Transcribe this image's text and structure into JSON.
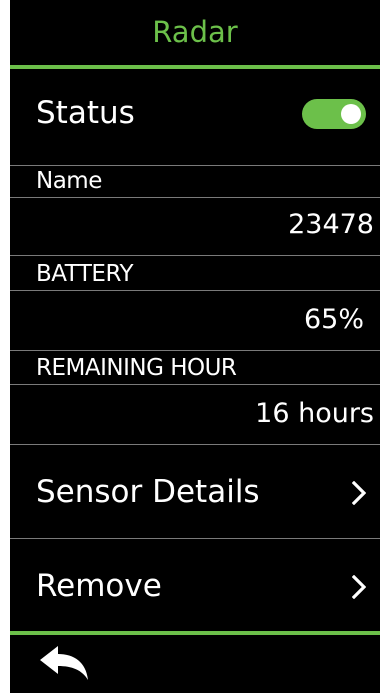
{
  "header": {
    "title": "Radar",
    "accent_color": "#6cc04a"
  },
  "status": {
    "label": "Status",
    "toggle_on": true
  },
  "name": {
    "label": "Name",
    "value": "23478"
  },
  "battery": {
    "label": "BATTERY",
    "value": "65%"
  },
  "remaining": {
    "label": "REMAINING HOUR",
    "value": "16 hours"
  },
  "nav": {
    "sensor_details": {
      "label": "Sensor Details",
      "icon": "chevron-right-icon"
    },
    "remove": {
      "label": "Remove",
      "icon": "chevron-right-icon"
    }
  },
  "footer": {
    "back_icon": "back-arrow-icon"
  }
}
